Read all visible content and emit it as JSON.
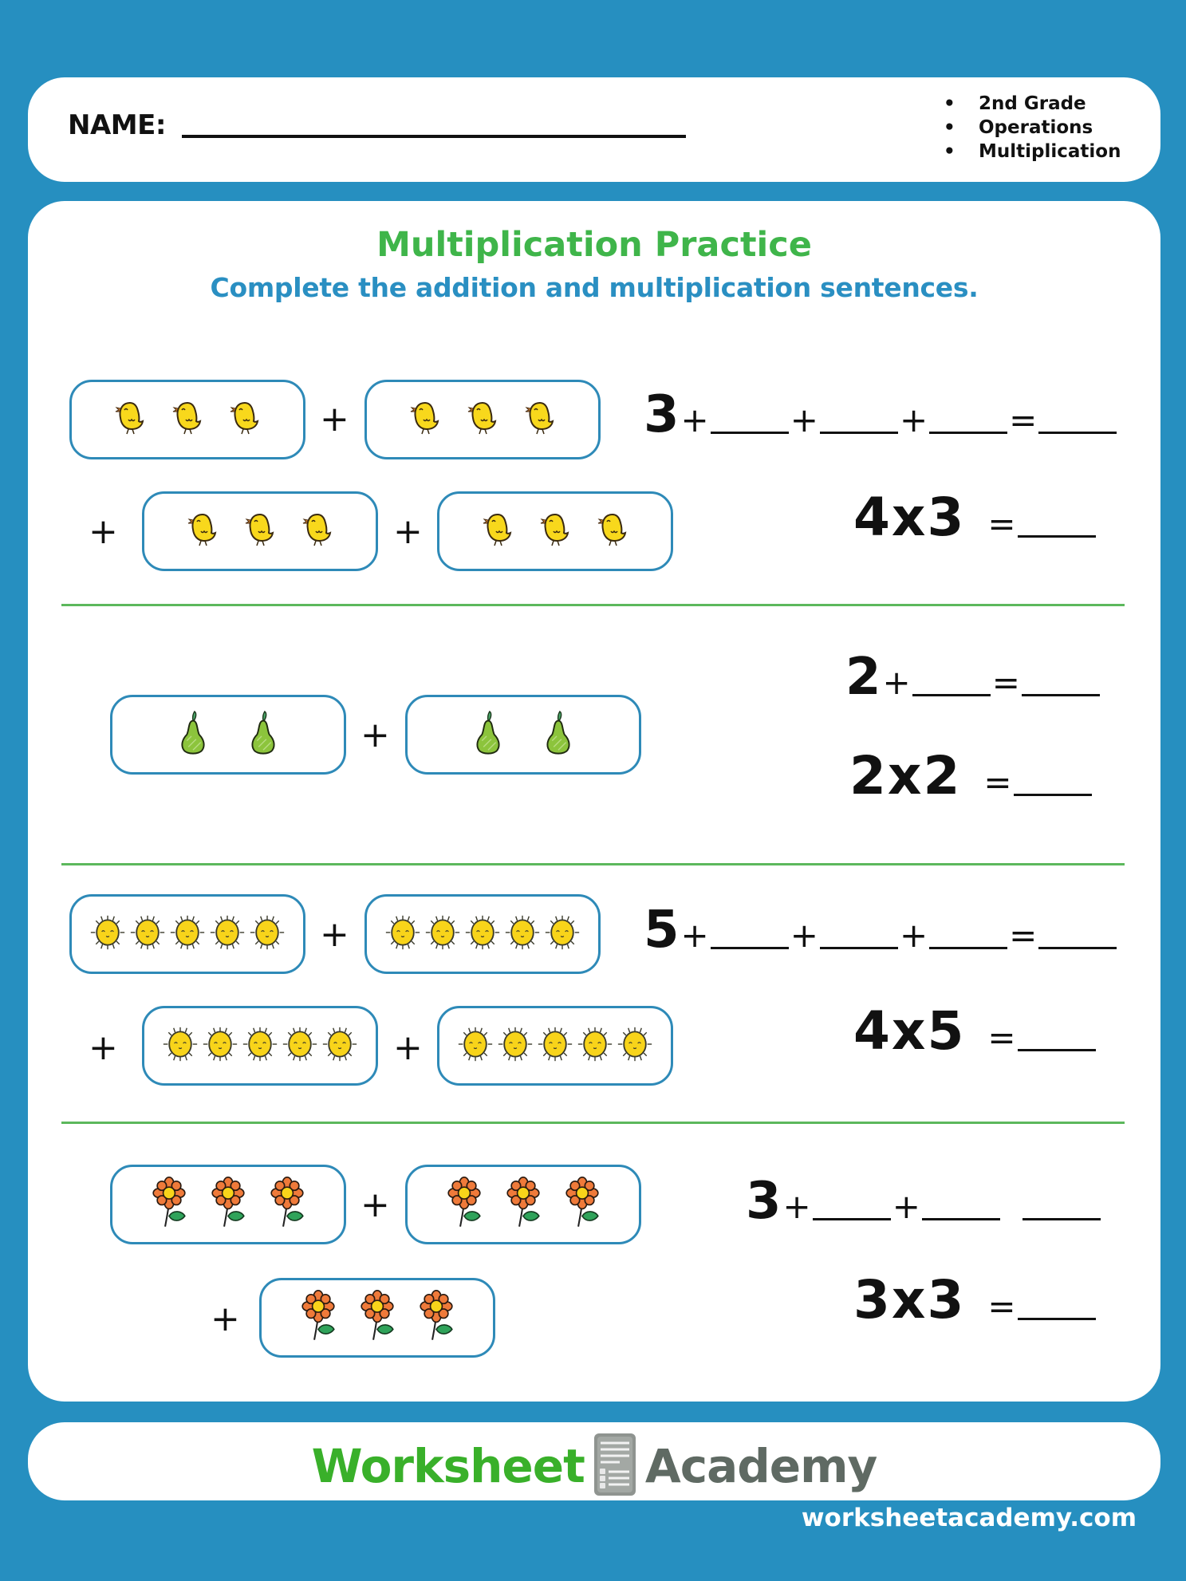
{
  "header": {
    "name_label": "NAME:",
    "tags": [
      "2nd Grade",
      "Operations",
      "Multiplication"
    ]
  },
  "worksheet": {
    "title": "Multiplication Practice",
    "subtitle": "Complete the addition and multiplication sentences.",
    "plus_sign": "+",
    "equals_sign": "=",
    "problems": [
      {
        "item_icon": "chick-icon",
        "groups": 4,
        "items_per_group": 3,
        "addition_start": "3",
        "addition_blanks": 3,
        "multiplication": "4x3"
      },
      {
        "item_icon": "pear-icon",
        "groups": 2,
        "items_per_group": 2,
        "addition_start": "2",
        "addition_blanks": 1,
        "multiplication": "2x2"
      },
      {
        "item_icon": "sun-icon",
        "groups": 4,
        "items_per_group": 5,
        "addition_start": "5",
        "addition_blanks": 3,
        "multiplication": "4x5"
      },
      {
        "item_icon": "flower-icon",
        "groups": 3,
        "items_per_group": 3,
        "addition_start": "3",
        "addition_blanks": 2,
        "multiplication": "3x3"
      }
    ]
  },
  "footer": {
    "brand_word_1": "Worksheet",
    "brand_word_2": "Academy",
    "logo_icon": "document-list-icon",
    "url": "worksheetacademy.com"
  },
  "colors": {
    "background": "#268fc0",
    "title_green": "#3fb54a",
    "subtitle_blue": "#2a8fc2",
    "box_border": "#2e8ab8",
    "divider_green": "#5cb85c",
    "brand_green": "#39b02a",
    "brand_gray": "#5f6a63"
  }
}
